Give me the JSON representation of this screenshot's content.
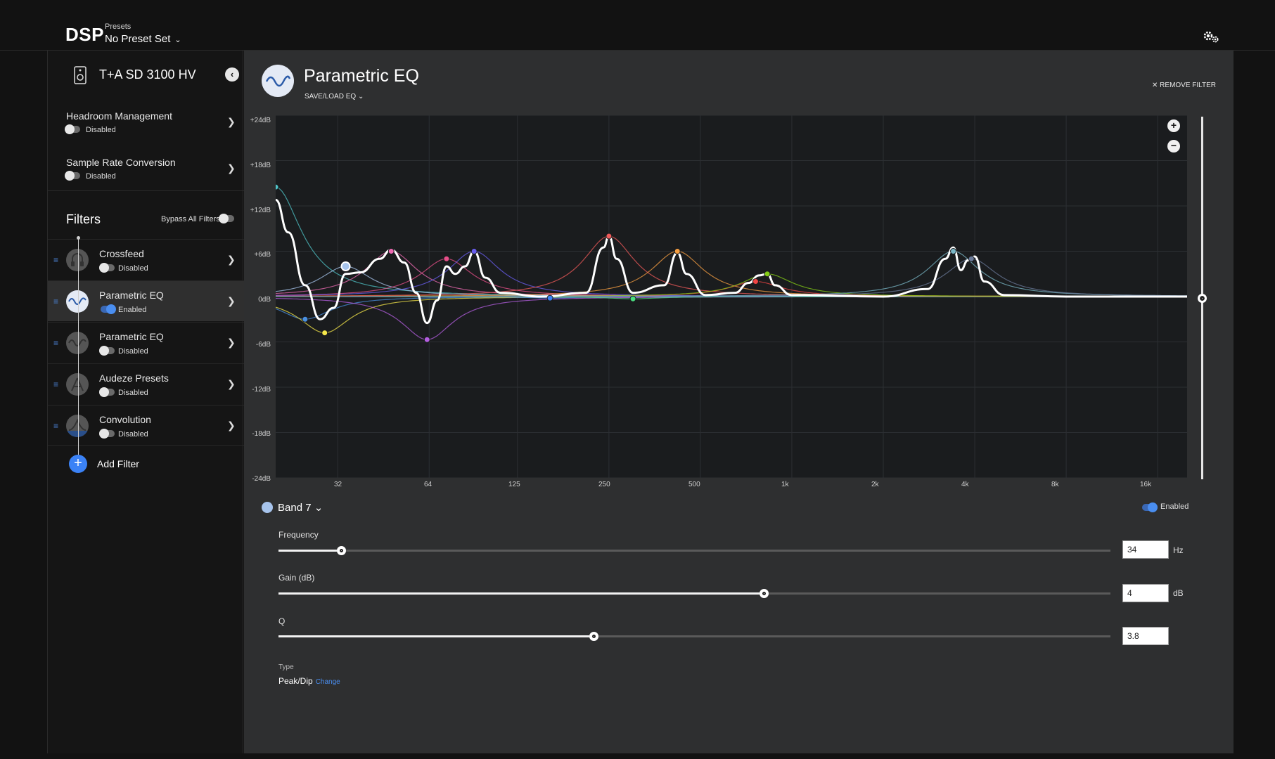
{
  "header": {
    "app_title": "DSP",
    "presets_label": "Presets",
    "presets_value": "No Preset Set"
  },
  "sidebar": {
    "device_name": "T+A SD 3100 HV",
    "settings": [
      {
        "label": "Headroom Management",
        "state": "Disabled"
      },
      {
        "label": "Sample Rate Conversion",
        "state": "Disabled"
      }
    ],
    "filters_title": "Filters",
    "bypass_label": "Bypass All Filters",
    "filters": [
      {
        "name": "Crossfeed",
        "state": "Disabled",
        "enabled": false
      },
      {
        "name": "Parametric EQ",
        "state": "Enabled",
        "enabled": true
      },
      {
        "name": "Parametric EQ",
        "state": "Disabled",
        "enabled": false
      },
      {
        "name": "Audeze Presets",
        "state": "Disabled",
        "enabled": false
      },
      {
        "name": "Convolution",
        "state": "Disabled",
        "enabled": false
      }
    ],
    "add_filter_label": "Add Filter"
  },
  "main": {
    "title": "Parametric EQ",
    "saveload_label": "SAVE/LOAD EQ",
    "remove_label": "REMOVE FILTER",
    "band_label": "Band 7",
    "band_enabled_label": "Enabled",
    "params": {
      "frequency": {
        "label": "Frequency",
        "value": "34",
        "unit": "Hz",
        "fraction": 0.075
      },
      "gain": {
        "label": "Gain (dB)",
        "value": "4",
        "unit": "dB",
        "fraction": 0.583
      },
      "q": {
        "label": "Q",
        "value": "3.8",
        "unit": "",
        "fraction": 0.379
      }
    },
    "type_label": "Type",
    "type_value": "Peak/Dip",
    "type_change": "Change"
  },
  "chart_data": {
    "type": "line",
    "y_ticks": [
      "+24dB",
      "+18dB",
      "+12dB",
      "+6dB",
      "0dB",
      "-6dB",
      "-12dB",
      "-18dB",
      "-24dB"
    ],
    "x_ticks": [
      "32",
      "64",
      "125",
      "250",
      "500",
      "1k",
      "2k",
      "4k",
      "8k",
      "16k"
    ],
    "ylim": [
      -24,
      24
    ],
    "xscale": "log",
    "xlim": [
      20,
      20000
    ],
    "response_points": [
      [
        20,
        12.8
      ],
      [
        22,
        8.5
      ],
      [
        25,
        1.5
      ],
      [
        28,
        -3.0
      ],
      [
        31,
        -1.5
      ],
      [
        34,
        3.0
      ],
      [
        38,
        3.2
      ],
      [
        44,
        5.0
      ],
      [
        48,
        6.2
      ],
      [
        53,
        4.5
      ],
      [
        58,
        0.5
      ],
      [
        63,
        -3.5
      ],
      [
        68,
        -0.5
      ],
      [
        73,
        4.0
      ],
      [
        78,
        3.0
      ],
      [
        84,
        4.0
      ],
      [
        90,
        6.0
      ],
      [
        98,
        2.5
      ],
      [
        110,
        0.5
      ],
      [
        150,
        0.0
      ],
      [
        210,
        0.5
      ],
      [
        240,
        6.5
      ],
      [
        250,
        8.0
      ],
      [
        265,
        5.0
      ],
      [
        300,
        0.5
      ],
      [
        380,
        1.5
      ],
      [
        420,
        5.8
      ],
      [
        450,
        3.0
      ],
      [
        520,
        0.2
      ],
      [
        650,
        0.5
      ],
      [
        720,
        1.8
      ],
      [
        780,
        2.8
      ],
      [
        830,
        3.0
      ],
      [
        880,
        1.5
      ],
      [
        1000,
        0.2
      ],
      [
        2000,
        0.0
      ],
      [
        2800,
        1.0
      ],
      [
        3200,
        5.0
      ],
      [
        3400,
        6.5
      ],
      [
        3600,
        3.5
      ],
      [
        3800,
        4.8
      ],
      [
        4000,
        5.3
      ],
      [
        4300,
        2.0
      ],
      [
        5000,
        0.2
      ],
      [
        8000,
        0.0
      ],
      [
        20000,
        0.0
      ]
    ],
    "band_points": [
      {
        "freq": 20,
        "gain": 14.5,
        "color": "#4fc3c7"
      },
      {
        "freq": 25,
        "gain": -3.0,
        "color": "#4a90e2"
      },
      {
        "freq": 29,
        "gain": -4.8,
        "color": "#f5e74a"
      },
      {
        "freq": 34,
        "gain": 4.0,
        "color": "#a7c4ec"
      },
      {
        "freq": 48,
        "gain": 6.0,
        "color": "#ec6ab1"
      },
      {
        "freq": 63,
        "gain": -5.7,
        "color": "#b45ee0"
      },
      {
        "freq": 73,
        "gain": 5.0,
        "color": "#e84f8a"
      },
      {
        "freq": 90,
        "gain": 6.0,
        "color": "#6a5ef0"
      },
      {
        "freq": 160,
        "gain": -0.2,
        "color": "#3b82f6"
      },
      {
        "freq": 250,
        "gain": 8.0,
        "color": "#ef5a5a"
      },
      {
        "freq": 300,
        "gain": -0.3,
        "color": "#4ade80"
      },
      {
        "freq": 420,
        "gain": 6.0,
        "color": "#f59e42"
      },
      {
        "freq": 760,
        "gain": 2.0,
        "color": "#ef4444"
      },
      {
        "freq": 830,
        "gain": 3.0,
        "color": "#84cc16"
      },
      {
        "freq": 3400,
        "gain": 6.0,
        "color": "#7ab7c7"
      },
      {
        "freq": 3900,
        "gain": 5.0,
        "color": "#6b7a99"
      }
    ]
  }
}
